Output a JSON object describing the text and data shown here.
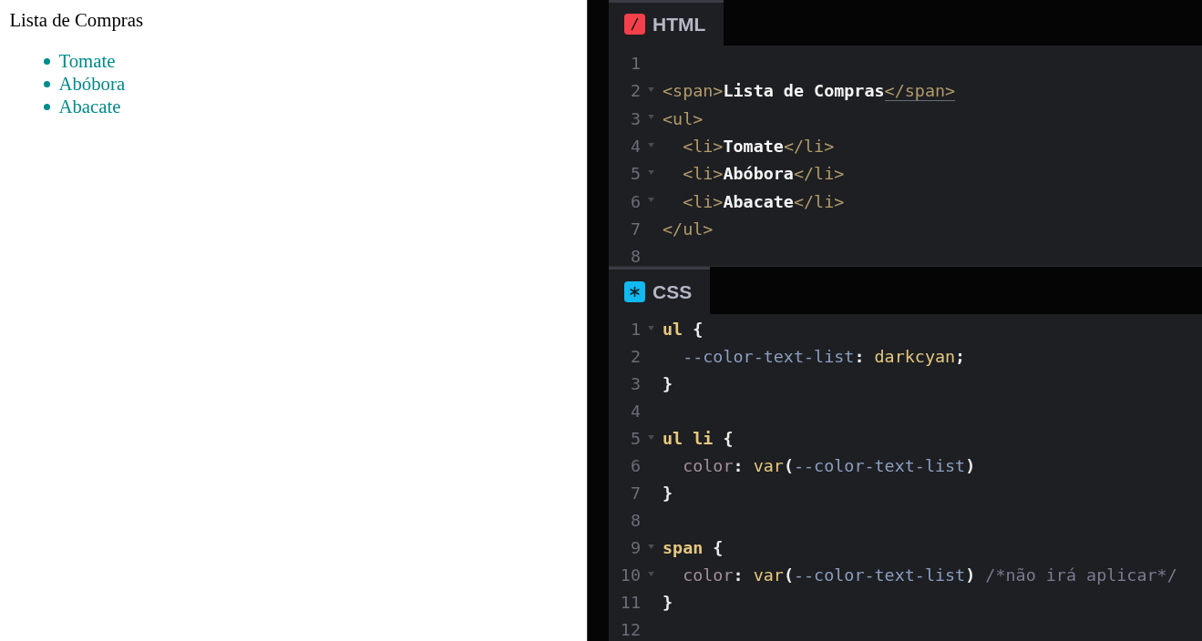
{
  "preview": {
    "title": "Lista de Compras",
    "items": [
      "Tomate",
      "Abóbora",
      "Abacate"
    ]
  },
  "editors": [
    {
      "kind": "html",
      "tab": {
        "label": "HTML",
        "selected": true
      },
      "lines": [
        {
          "number": "1",
          "foldable": false
        },
        {
          "number": "2",
          "foldable": true,
          "tokens": [
            {
              "kind": "tag",
              "text": "<span>"
            },
            {
              "kind": "text",
              "text": "Lista de Compras"
            },
            {
              "kind": "tag-match",
              "text": "</span>"
            }
          ]
        },
        {
          "number": "3",
          "foldable": true,
          "tokens": [
            {
              "kind": "tag",
              "text": "<ul>"
            }
          ],
          "children": [
            {
              "number": "4",
              "foldable": true,
              "tokens": [
                {
                  "kind": "tag",
                  "text": "<li>"
                },
                {
                  "kind": "text",
                  "text": "Tomate"
                },
                {
                  "kind": "tag",
                  "text": "</li>"
                }
              ]
            },
            {
              "number": "5",
              "foldable": true,
              "tokens": [
                {
                  "kind": "tag",
                  "text": "<li>"
                },
                {
                  "kind": "text",
                  "text": "Abóbora"
                },
                {
                  "kind": "tag",
                  "text": "</li>"
                }
              ]
            },
            {
              "number": "6",
              "foldable": true,
              "tokens": [
                {
                  "kind": "tag",
                  "text": "<li>"
                },
                {
                  "kind": "text",
                  "text": "Abacate"
                },
                {
                  "kind": "tag",
                  "text": "</li>"
                }
              ]
            }
          ]
        },
        {
          "number": "7",
          "foldable": false,
          "tokens": [
            {
              "kind": "tag",
              "text": "</ul>"
            }
          ]
        },
        {
          "number": "8",
          "foldable": false
        }
      ]
    },
    {
      "kind": "css",
      "tab": {
        "label": "CSS",
        "selected": true
      },
      "lines": [
        {
          "number": "1",
          "foldable": true,
          "tokens": [
            {
              "kind": "selector",
              "text": "ul"
            },
            {
              "kind": "punct",
              "text": " {"
            }
          ],
          "children": [
            {
              "number": "2",
              "foldable": false,
              "tokens": [
                {
                  "kind": "variable",
                  "text": "--color-text-list"
                },
                {
                  "kind": "punct",
                  "text": ": "
                },
                {
                  "kind": "value",
                  "text": "darkcyan"
                },
                {
                  "kind": "punct",
                  "text": ";"
                }
              ]
            }
          ]
        },
        {
          "number": "3",
          "foldable": false,
          "tokens": [
            {
              "kind": "punct",
              "text": "}"
            }
          ]
        },
        {
          "number": "4",
          "foldable": false
        },
        {
          "number": "5",
          "foldable": true,
          "tokens": [
            {
              "kind": "selector",
              "text": "ul li"
            },
            {
              "kind": "punct",
              "text": " {"
            }
          ],
          "children": [
            {
              "number": "6",
              "foldable": false,
              "tokens": [
                {
                  "kind": "property",
                  "text": "color"
                },
                {
                  "kind": "punct",
                  "text": ": "
                },
                {
                  "kind": "function",
                  "text": "var"
                },
                {
                  "kind": "punct",
                  "text": "("
                },
                {
                  "kind": "variable",
                  "text": "--color-text-list"
                },
                {
                  "kind": "punct",
                  "text": ")"
                }
              ]
            }
          ]
        },
        {
          "number": "7",
          "foldable": false,
          "tokens": [
            {
              "kind": "punct",
              "text": "}"
            }
          ]
        },
        {
          "number": "8",
          "foldable": false
        },
        {
          "number": "9",
          "foldable": true,
          "tokens": [
            {
              "kind": "selector",
              "text": "span"
            },
            {
              "kind": "punct",
              "text": " {"
            }
          ],
          "children": [
            {
              "number": "10",
              "foldable": true,
              "tokens": [
                {
                  "kind": "property",
                  "text": "color"
                },
                {
                  "kind": "punct",
                  "text": ": "
                },
                {
                  "kind": "function",
                  "text": "var"
                },
                {
                  "kind": "punct",
                  "text": "("
                },
                {
                  "kind": "variable",
                  "text": "--color-text-list"
                },
                {
                  "kind": "punct",
                  "text": ") "
                },
                {
                  "kind": "comment",
                  "text": "/*não irá aplicar*/"
                }
              ]
            }
          ]
        },
        {
          "number": "11",
          "foldable": false,
          "tokens": [
            {
              "kind": "punct",
              "text": "}"
            }
          ]
        },
        {
          "number": "12",
          "foldable": false
        }
      ]
    }
  ]
}
